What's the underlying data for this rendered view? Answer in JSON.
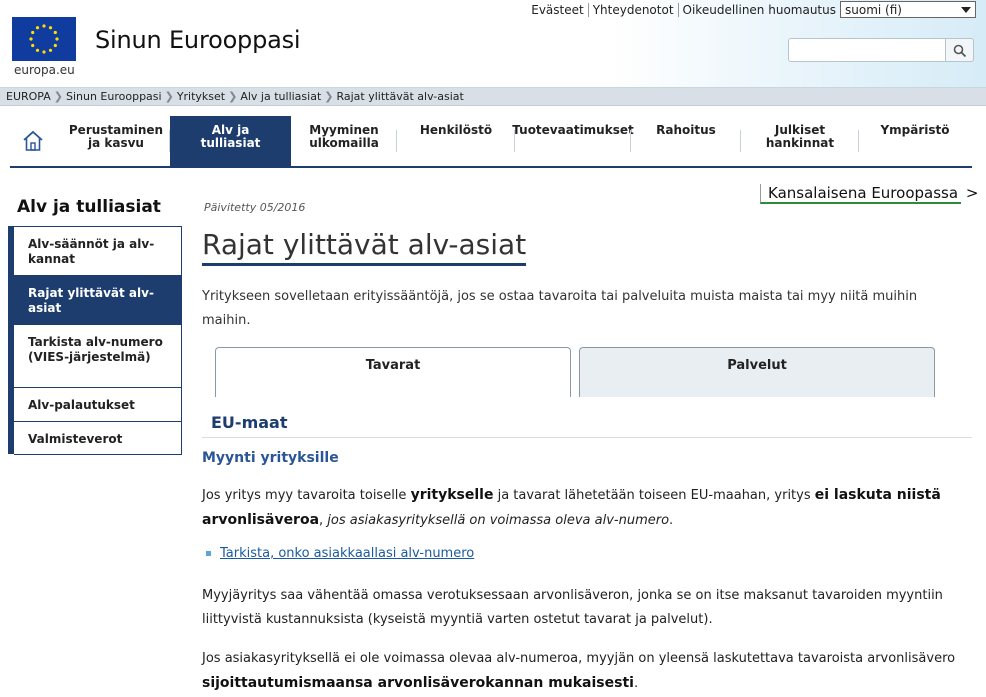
{
  "header": {
    "logo_caption": "europa.eu",
    "site_title": "Sinun Eurooppasi",
    "utility_links": [
      "Evästeet",
      "Yhteydenotot",
      "Oikeudellinen huomautus"
    ],
    "language": "suomi (fi)",
    "search_placeholder": ""
  },
  "breadcrumb": [
    "EUROPA",
    "Sinun Eurooppasi",
    "Yritykset",
    "Alv ja tulliasiat",
    "Rajat ylittävät alv-asiat"
  ],
  "nav": {
    "items": [
      {
        "line1": "Perustaminen",
        "line2": "ja kasvu"
      },
      {
        "line1": "Alv ja",
        "line2": "tulliasiat"
      },
      {
        "line1": "Myyminen",
        "line2": "ulkomailla"
      },
      {
        "line1": "Henkilöstö",
        "line2": ""
      },
      {
        "line1": "Tuotevaatimukset",
        "line2": ""
      },
      {
        "line1": "Rahoitus",
        "line2": ""
      },
      {
        "line1": "Julkiset",
        "line2": "hankinnat"
      },
      {
        "line1": "Ympäristö",
        "line2": ""
      }
    ]
  },
  "sidebar": {
    "title": "Alv ja tulliasiat",
    "items": [
      {
        "label": "Alv-säännöt ja alv-kannat"
      },
      {
        "label": "Rajat ylittävät alv-asiat"
      },
      {
        "label": "Tarkista alv-numero (VIES-järjestelmä)"
      },
      {
        "label": "Alv-palautukset"
      },
      {
        "label": "Valmisteverot"
      }
    ]
  },
  "content": {
    "citizen_link": "Kansalaisena Euroopassa",
    "citizen_arrow": ">",
    "updated": "Päivitetty 05/2016",
    "title": "Rajat ylittävät alv-asiat",
    "intro": "Yritykseen sovelletaan erityissääntöjä, jos se ostaa tavaroita tai palveluita muista maista tai myy niitä muihin maihin.",
    "tabs": [
      "Tavarat",
      "Palvelut"
    ],
    "section_title": "EU-maat",
    "subheading": "Myynti yrityksille",
    "p1": {
      "a": "Jos yritys myy tavaroita toiselle ",
      "b": "yritykselle",
      "c": " ja tavarat lähetetään toiseen EU-maahan, yritys ",
      "d": "ei laskuta niistä arvonlisäveroa",
      "e": ", ",
      "f": "jos asiakasyrityksellä on voimassa oleva alv-numero",
      "g": "."
    },
    "link": "Tarkista, onko asiakkaallasi alv-numero",
    "p2": "Myyjäyritys saa vähentää omassa verotuksessaan arvonlisäveron, jonka se on itse maksanut tavaroiden myyntiin liittyvistä kustannuksista (kyseistä myyntiä varten ostetut tavarat ja palvelut).",
    "p3": {
      "a": "Jos asiakasyrityksellä ei ole voimassa olevaa alv-numeroa, myyjän on yleensä laskutettava tavaroista arvonlisävero ",
      "b": "sijoittautumismaansa arvonlisäverokannan mukaisesti",
      "c": "."
    }
  }
}
